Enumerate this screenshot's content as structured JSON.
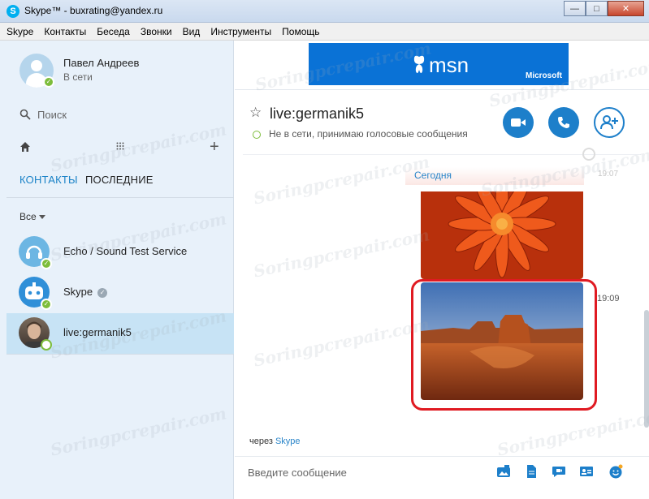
{
  "window": {
    "title": "Skype™ - buxrating@yandex.ru",
    "app_icon_glyph": "S"
  },
  "menu": [
    "Skype",
    "Контакты",
    "Беседа",
    "Звонки",
    "Вид",
    "Инструменты",
    "Помощь"
  ],
  "profile": {
    "name": "Павел Андреев",
    "status": "В сети"
  },
  "search": {
    "placeholder": "Поиск"
  },
  "tabs": {
    "contacts": "КОНТАКТЫ",
    "recent": "ПОСЛЕДНИЕ"
  },
  "filter": {
    "label": "Все"
  },
  "contacts": [
    {
      "name": "Echo / Sound Test Service",
      "status": "online",
      "icon": "echo-avatar"
    },
    {
      "name": "Skype",
      "status": "online",
      "icon": "skype-bot-avatar",
      "verified": true
    },
    {
      "name": "live:germanik5",
      "status": "offline",
      "icon": "person-avatar",
      "selected": true
    }
  ],
  "ad": {
    "brand": "msn",
    "sponsor": "Microsoft"
  },
  "chat": {
    "name": "live:germanik5",
    "presence": "Не в сети, принимаю голосовые сообщения",
    "day_label": "Сегодня",
    "time_first": "19:07",
    "time_second": "19:09",
    "via_prefix": "через",
    "via_link": "Skype",
    "input_placeholder": "Введите сообщение"
  },
  "watermark": "Soringpcrepair.com",
  "colors": {
    "accent": "#1d7fca",
    "online": "#7dbd3b",
    "highlight": "#e01a22",
    "msn": "#0a72d6"
  }
}
